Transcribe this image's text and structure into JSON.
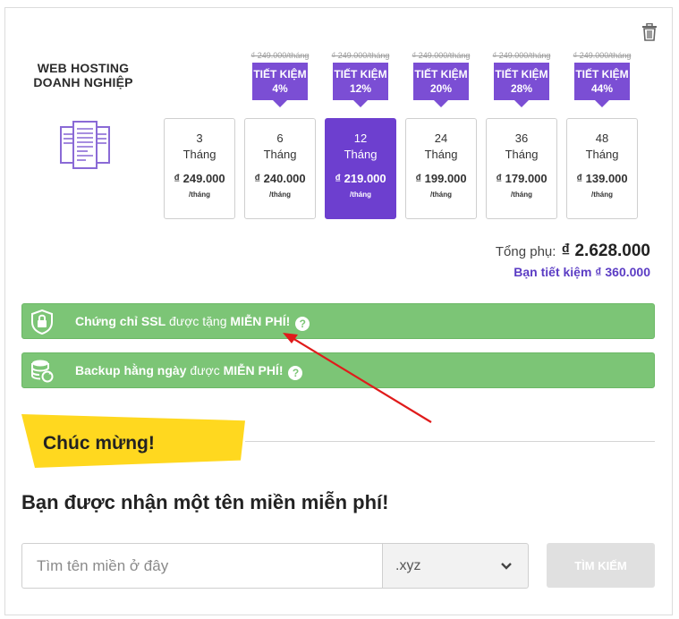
{
  "product": {
    "title": "WEB HOSTING\nDOANH NGHIỆP",
    "icon": "server-documents-icon"
  },
  "plans": [
    {
      "months": "3",
      "month_label": "Tháng",
      "price": "₫ 249.000",
      "unit": "/tháng",
      "old_price": "",
      "badge_title": "",
      "badge_percent": "",
      "selected": false
    },
    {
      "months": "6",
      "month_label": "Tháng",
      "price": "₫ 240.000",
      "unit": "/tháng",
      "old_price": "₫ 249.000/tháng",
      "badge_title": "TIẾT KIỆM",
      "badge_percent": "4%",
      "selected": false
    },
    {
      "months": "12",
      "month_label": "Tháng",
      "price": "₫ 219.000",
      "unit": "/tháng",
      "old_price": "₫ 249.000/tháng",
      "badge_title": "TIẾT KIỆM",
      "badge_percent": "12%",
      "selected": true
    },
    {
      "months": "24",
      "month_label": "Tháng",
      "price": "₫ 199.000",
      "unit": "/tháng",
      "old_price": "₫ 249.000/tháng",
      "badge_title": "TIẾT KIỆM",
      "badge_percent": "20%",
      "selected": false
    },
    {
      "months": "36",
      "month_label": "Tháng",
      "price": "₫ 179.000",
      "unit": "/tháng",
      "old_price": "₫ 249.000/tháng",
      "badge_title": "TIẾT KIỆM",
      "badge_percent": "28%",
      "selected": false
    },
    {
      "months": "48",
      "month_label": "Tháng",
      "price": "₫ 139.000",
      "unit": "/tháng",
      "old_price": "₫ 249.000/tháng",
      "badge_title": "TIẾT KIỆM",
      "badge_percent": "44%",
      "selected": false
    }
  ],
  "summary": {
    "subtotal_label": "Tổng phụ:",
    "subtotal_value": "₫ 2.628.000",
    "savings": "Bạn tiết kiệm ₫ 360.000"
  },
  "bonuses": {
    "ssl": {
      "lead": "Chứng chỉ SSL",
      "mid": " được tặng ",
      "tail": "MIỄN PHÍ!",
      "icon": "shield-lock-icon"
    },
    "backup": {
      "lead": "Backup hằng ngày",
      "mid": " được ",
      "tail": "MIỄN PHÍ!",
      "icon": "database-refresh-icon"
    },
    "help_glyph": "?"
  },
  "promo": {
    "congrats": "Chúc mừng!",
    "headline": "Bạn được nhận một tên miền miễn phí!"
  },
  "domain_search": {
    "placeholder": "Tìm tên miền ở đây",
    "tld": ".xyz",
    "button": "TÌM KIẾM"
  },
  "colors": {
    "purple": "#6d3fcf",
    "badge_purple": "#7b4ed4",
    "green": "#7cc576",
    "yellow": "#ffd81f",
    "arrow_red": "#e01b1b"
  }
}
